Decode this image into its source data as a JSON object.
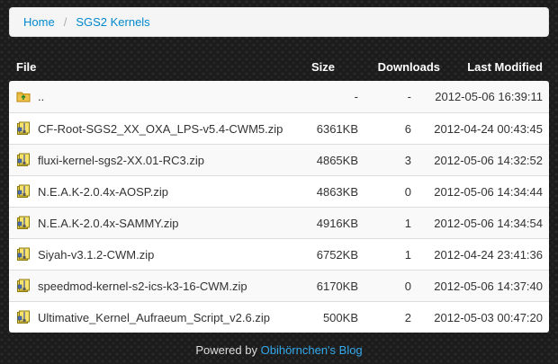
{
  "breadcrumb": {
    "home_label": "Home",
    "separator": "/",
    "current_label": "SGS2 Kernels"
  },
  "table": {
    "headers": {
      "file": "File",
      "size": "Size",
      "downloads": "Downloads",
      "modified": "Last Modified"
    },
    "rows": [
      {
        "icon": "folder-up-icon",
        "name": "..",
        "size": "-",
        "downloads": "-",
        "modified": "2012-05-06 16:39:11"
      },
      {
        "icon": "zip-archive-icon",
        "name": "CF-Root-SGS2_XX_OXA_LPS-v5.4-CWM5.zip",
        "size": "6361KB",
        "downloads": "6",
        "modified": "2012-04-24 00:43:45"
      },
      {
        "icon": "zip-archive-icon",
        "name": "fluxi-kernel-sgs2-XX.01-RC3.zip",
        "size": "4865KB",
        "downloads": "3",
        "modified": "2012-05-06 14:32:52"
      },
      {
        "icon": "zip-archive-icon",
        "name": "N.E.A.K-2.0.4x-AOSP.zip",
        "size": "4863KB",
        "downloads": "0",
        "modified": "2012-05-06 14:34:44"
      },
      {
        "icon": "zip-archive-icon",
        "name": "N.E.A.K-2.0.4x-SAMMY.zip",
        "size": "4916KB",
        "downloads": "1",
        "modified": "2012-05-06 14:34:54"
      },
      {
        "icon": "zip-archive-icon",
        "name": "Siyah-v3.1.2-CWM.zip",
        "size": "6752KB",
        "downloads": "1",
        "modified": "2012-04-24 23:41:36"
      },
      {
        "icon": "zip-archive-icon",
        "name": "speedmod-kernel-s2-ics-k3-16-CWM.zip",
        "size": "6170KB",
        "downloads": "0",
        "modified": "2012-05-06 14:37:40"
      },
      {
        "icon": "zip-archive-icon",
        "name": "Ultimative_Kernel_Aufraeum_Script_v2.6.zip",
        "size": "500KB",
        "downloads": "2",
        "modified": "2012-05-03 00:47:20"
      }
    ]
  },
  "footer": {
    "prefix": "Powered by",
    "link_label": "Obihörnchen's Blog"
  },
  "colors": {
    "link": "#0088cc",
    "footer_link": "#33aaee",
    "background": "#1c1c1c"
  }
}
